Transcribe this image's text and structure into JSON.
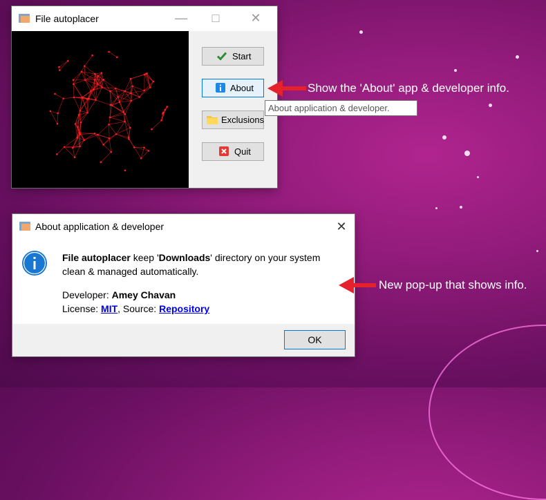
{
  "main_window": {
    "title": "File autoplacer",
    "buttons": {
      "start": "Start",
      "about": "About",
      "exclusions": "Exclusions",
      "quit": "Quit"
    }
  },
  "tooltip": "About application & developer.",
  "annotations": {
    "about_note": "Show the 'About' app & developer info.",
    "popup_note": "New pop-up that shows info."
  },
  "dialog": {
    "title": "About application & developer",
    "app_name": "File autoplacer",
    "desc_1": " keep '",
    "folder": "Downloads",
    "desc_2": "' directory on your system",
    "desc_3": "clean & managed automatically.",
    "developer_label": "Developer: ",
    "developer_name": "Amey Chavan",
    "license_label": "License: ",
    "license_link": "MIT",
    "source_label": ", Source: ",
    "source_link": "Repository",
    "ok": "OK"
  },
  "colors": {
    "accent": "#0078d7",
    "arrow": "#e5222b",
    "particles": "#ff2020"
  }
}
